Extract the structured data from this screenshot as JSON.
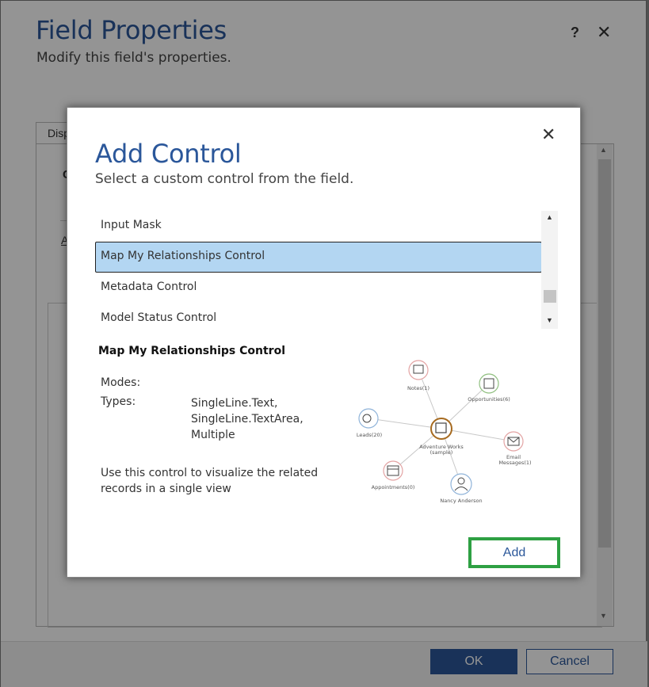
{
  "outer_dialog": {
    "title": "Field Properties",
    "subtitle": "Modify this field's properties.",
    "help_glyph": "?",
    "close_glyph": "✕",
    "tab_label": "Disp",
    "partial_heading": "C",
    "partial_link": "A",
    "ok_label": "OK",
    "cancel_label": "Cancel"
  },
  "modal": {
    "title": "Add Control",
    "subtitle": "Select a custom control from the field.",
    "close_glyph": "✕",
    "controls": [
      {
        "label": "Input Mask",
        "selected": false
      },
      {
        "label": "Map My Relationships Control",
        "selected": true
      },
      {
        "label": "Metadata Control",
        "selected": false
      },
      {
        "label": "Model Status Control",
        "selected": false
      }
    ],
    "detail": {
      "name": "Map My Relationships Control",
      "modes_label": "Modes:",
      "types_label": "Types:",
      "types": [
        "SingleLine.Text,",
        "SingleLine.TextArea,",
        "Multiple"
      ],
      "description": "Use this control to visualize the related records in a single view"
    },
    "preview_nodes": {
      "center_1": "Adventure Works",
      "center_2": "(sample)",
      "notes": "Notes(1)",
      "opportunities": "Opportunities(6)",
      "leads": "Leads(20)",
      "email_1": "Email",
      "email_2": "Messages(1)",
      "appointments": "Appointments(0)",
      "contact": "Nancy Anderson"
    },
    "add_label": "Add"
  },
  "colors": {
    "accent": "#2b579a",
    "selected_row": "#b3d6f2",
    "add_highlight": "#2ea043"
  }
}
